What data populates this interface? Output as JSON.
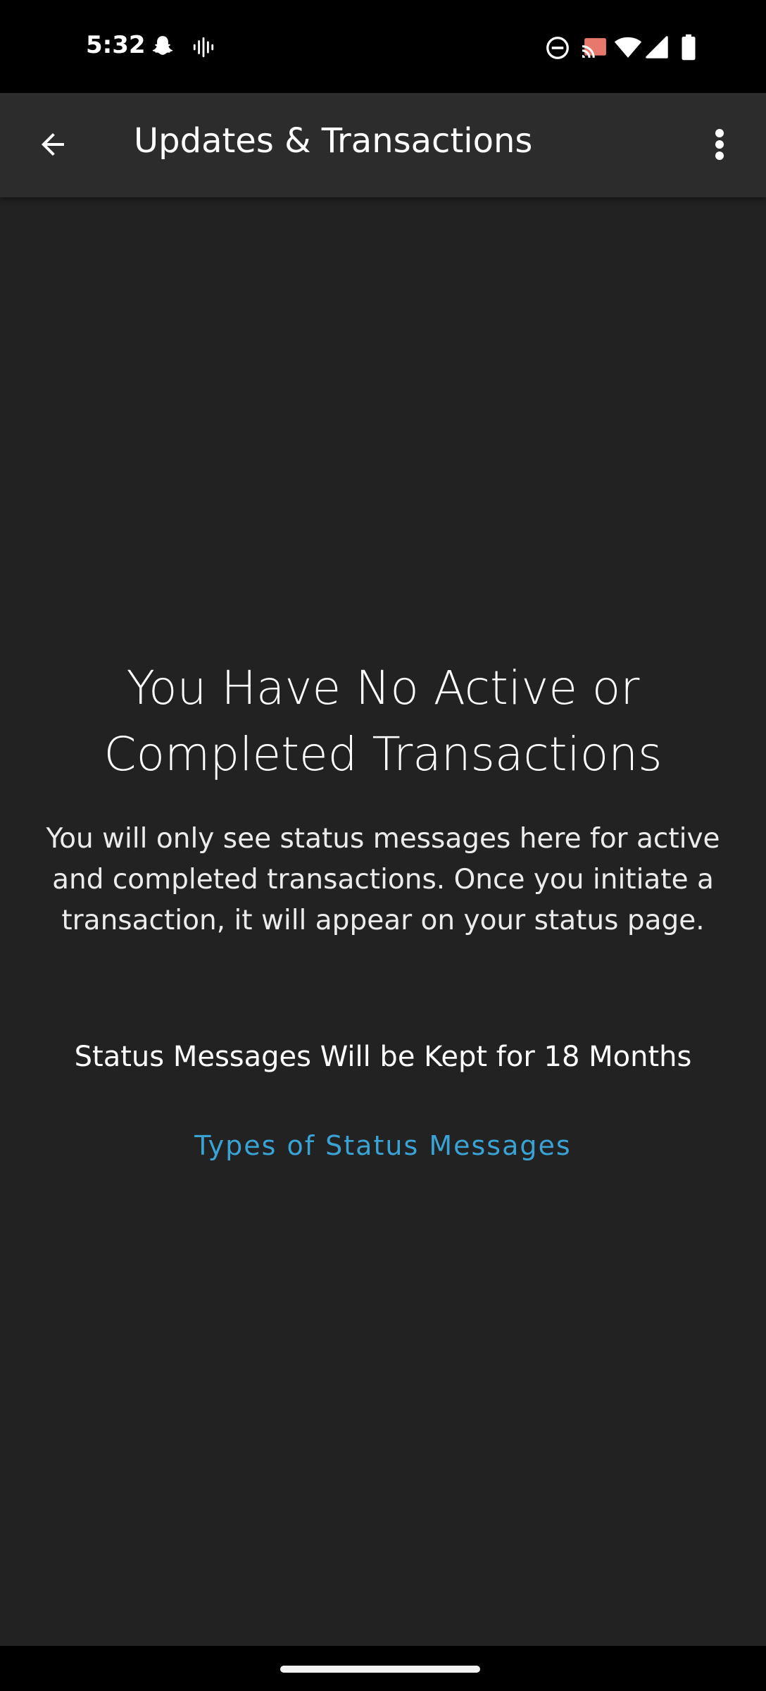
{
  "status_bar": {
    "time": "5:32",
    "icons": [
      "snapchat-icon",
      "voice-waveform-icon",
      "do-not-disturb-icon",
      "cast-icon",
      "wifi-icon",
      "signal-icon",
      "battery-icon"
    ]
  },
  "app_bar": {
    "title": "Updates & Transactions",
    "back_icon": "arrow-back-icon",
    "overflow_icon": "more-vert-icon"
  },
  "empty_state": {
    "title": "You Have No Active or Completed Transactions",
    "description": "You will only see status messages here for active and completed transactions. Once you initiate a transaction, it will appear on your status page.",
    "retention_note": "Status Messages Will be Kept for 18 Months",
    "types_link": "Types of Status Messages"
  },
  "colors": {
    "background": "#222222",
    "app_bar": "#2c2c2c",
    "link": "#3aa3d6",
    "system_bars": "#000000"
  }
}
